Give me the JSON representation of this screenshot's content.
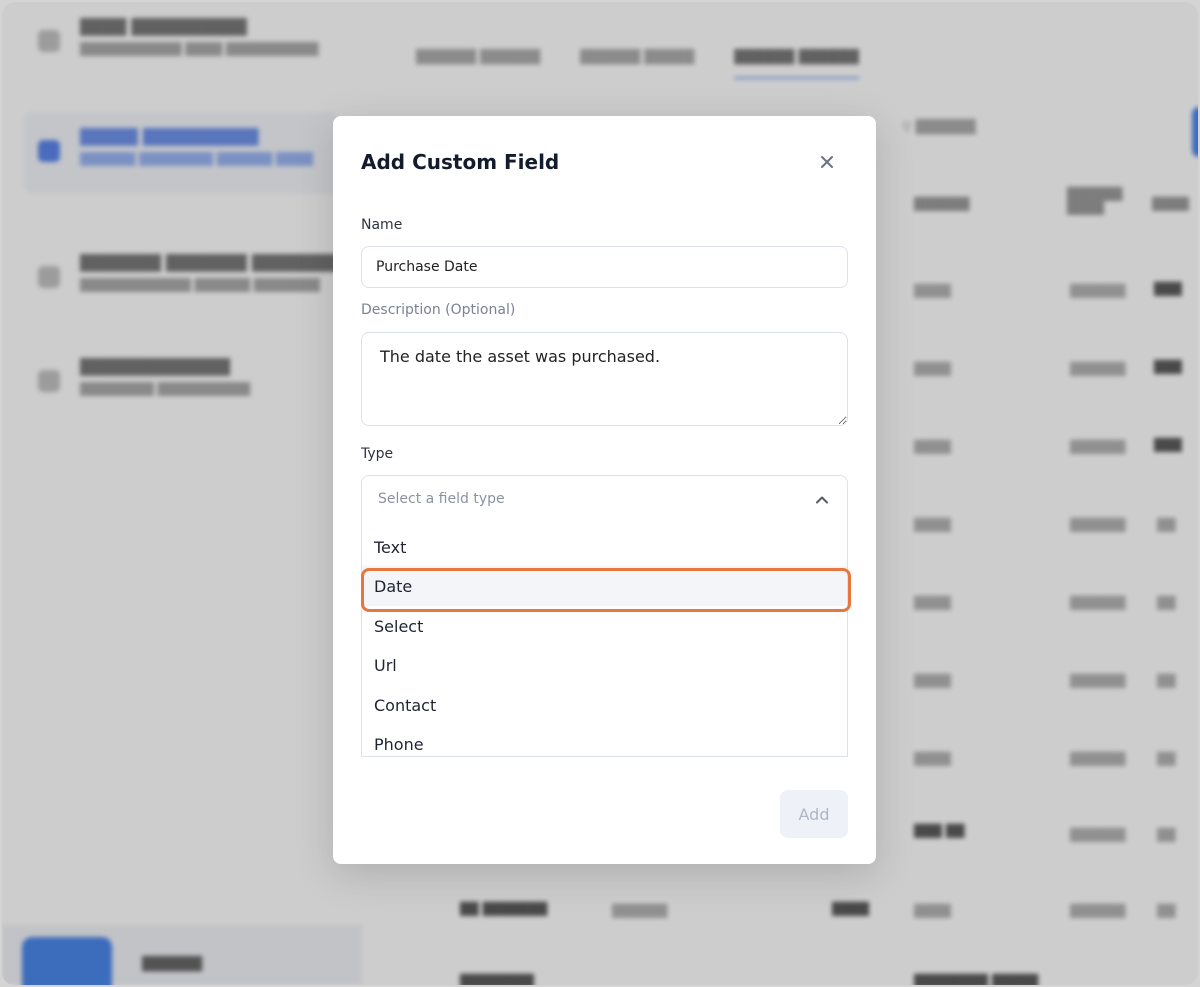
{
  "modal": {
    "title": "Add Custom Field",
    "name_label": "Name",
    "name_value": "Purchase Date",
    "description_label": "Description (Optional)",
    "description_value": "The date the asset was purchased.",
    "type_label": "Type",
    "type_placeholder": "Select a field type",
    "type_options": [
      "Text",
      "Date",
      "Select",
      "Url",
      "Contact",
      "Phone"
    ],
    "highlighted_option": "Date",
    "add_label": "Add"
  },
  "colors": {
    "highlight_ring": "#e8763f",
    "accent_blue": "#4a84e6"
  },
  "icons": {
    "close": "close-icon",
    "chevron": "chevron-up-icon",
    "resize": "resize-handle-icon"
  }
}
